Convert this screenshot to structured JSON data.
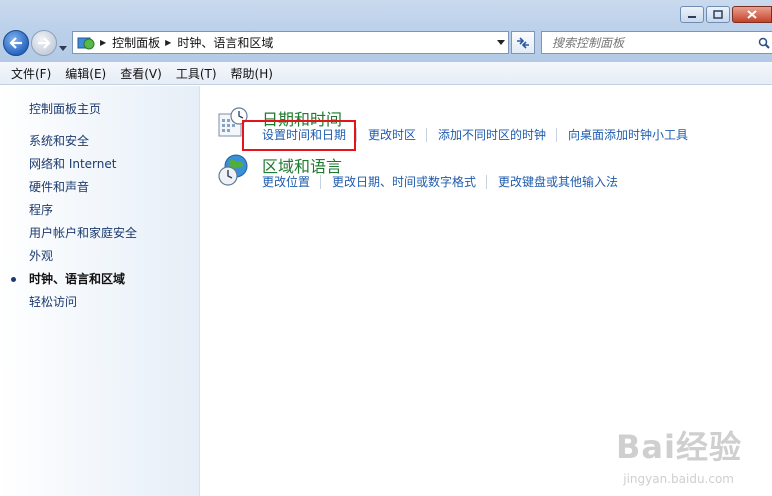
{
  "address": {
    "crumbs": [
      "控制面板",
      "时钟、语言和区域"
    ]
  },
  "search": {
    "placeholder": "搜索控制面板"
  },
  "menu": [
    "文件(F)",
    "编辑(E)",
    "查看(V)",
    "工具(T)",
    "帮助(H)"
  ],
  "leftpane": {
    "home": "控制面板主页",
    "categories": [
      {
        "label": "系统和安全",
        "active": false
      },
      {
        "label": "网络和 Internet",
        "active": false
      },
      {
        "label": "硬件和声音",
        "active": false
      },
      {
        "label": "程序",
        "active": false
      },
      {
        "label": "用户帐户和家庭安全",
        "active": false
      },
      {
        "label": "外观",
        "active": false
      },
      {
        "label": "时钟、语言和区域",
        "active": true
      },
      {
        "label": "轻松访问",
        "active": false
      }
    ]
  },
  "groups": [
    {
      "title": "日期和时间",
      "icon": "date-time-icon",
      "links": [
        "设置时间和日期",
        "更改时区",
        "添加不同时区的时钟",
        "向桌面添加时钟小工具"
      ]
    },
    {
      "title": "区域和语言",
      "icon": "globe-clock-icon",
      "links": [
        "更改位置",
        "更改日期、时间或数字格式",
        "更改键盘或其他输入法"
      ]
    }
  ],
  "watermark": {
    "main": "Bai经验",
    "sub": "jingyan.baidu.com"
  },
  "colors": {
    "link": "#1f5cae",
    "group_title": "#1e7a2e",
    "highlight": "#e4141a"
  }
}
